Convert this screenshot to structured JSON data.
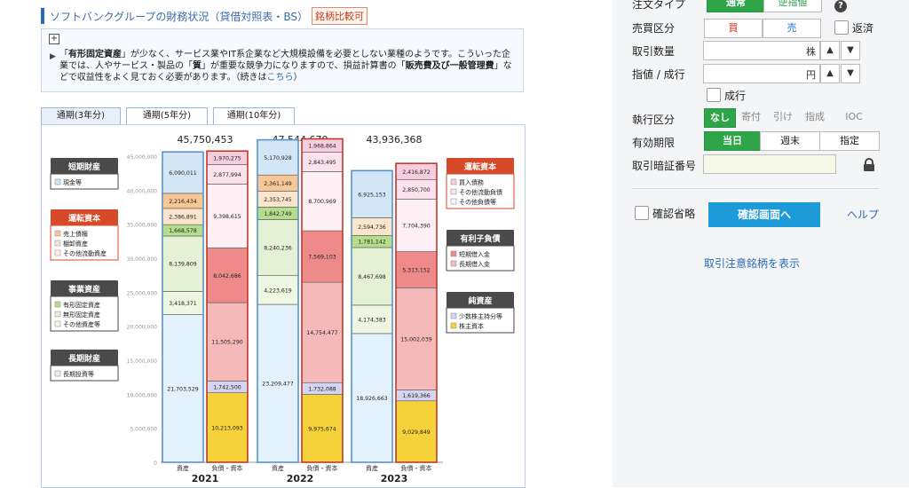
{
  "page": {
    "title": "ソフトバンクグループの財務状況（貸借対照表・BS）",
    "compare_link": "銘柄比較可"
  },
  "info_box": {
    "segments": [
      {
        "text": "「",
        "bold": false
      },
      {
        "text": "有形固定資産",
        "bold": true
      },
      {
        "text": "」が少なく、サービス業やIT系企業など大規模設備を必要としない業種のようです。こういった企業では、人やサービス・製品の「",
        "bold": false
      },
      {
        "text": "質",
        "bold": true
      },
      {
        "text": "」が重要な競争力になりますので、損益計算書の「",
        "bold": false
      },
      {
        "text": "販売費及び一般管理費",
        "bold": true
      },
      {
        "text": "」などで収益性をよく見ておく必要があります。（続きは",
        "bold": false
      }
    ],
    "link_text": "こちら",
    "tail": "）"
  },
  "tabs": [
    {
      "label": "通期(3年分)",
      "active": true
    },
    {
      "label": "通期(5年分)",
      "active": false
    },
    {
      "label": "通期(10年分)",
      "active": false
    }
  ],
  "chart_data": {
    "type": "bar",
    "ylim": [
      0,
      45000000
    ],
    "yticks": [
      "45,000,000",
      "40,000,000",
      "35,000,000",
      "30,000,000",
      "25,000,000",
      "20,000,000",
      "15,000,000",
      "10,000,000",
      "5,000,000",
      "0"
    ],
    "bar_labels": [
      "資産",
      "負債・資本"
    ],
    "years": [
      {
        "year": "2021",
        "total": "45,750,453",
        "assets": [
          {
            "key": "fixed_investment",
            "value": 21703529,
            "label": "21,703,529"
          },
          {
            "key": "other_assets",
            "value": 3418371,
            "label": "3,418,371"
          },
          {
            "key": "intangible",
            "value": 8139809,
            "label": "8,139,809"
          },
          {
            "key": "tangible",
            "value": 1668578,
            "label": "1,668,578"
          },
          {
            "key": "other_current",
            "value": 2386891,
            "label": "2,386,891"
          },
          {
            "key": "inventory",
            "value": 2216434,
            "label": "2,216,434"
          },
          {
            "key": "cash",
            "value": 6090011,
            "label": "6,090,011"
          }
        ],
        "liabilities": [
          {
            "key": "equity",
            "value": 10213093,
            "label": "10,213,093"
          },
          {
            "key": "minority",
            "value": 1742500,
            "label": "1,742,500"
          },
          {
            "key": "long_debt",
            "value": 11505290,
            "label": "11,505,290"
          },
          {
            "key": "short_debt",
            "value": 8042686,
            "label": "8,042,686"
          },
          {
            "key": "other_liab",
            "value": 9398615,
            "label": "9,398,615"
          },
          {
            "key": "other_current_liab",
            "value": 2877994,
            "label": "2,877,994"
          },
          {
            "key": "payables",
            "value": 1970275,
            "label": "1,970,275"
          }
        ]
      },
      {
        "year": "2022",
        "total": "47,544,670",
        "assets": [
          {
            "key": "fixed_investment",
            "value": 23209477,
            "label": "23,209,477"
          },
          {
            "key": "other_assets",
            "value": 4223619,
            "label": "4,223,619"
          },
          {
            "key": "intangible",
            "value": 8240236,
            "label": "8,240,236"
          },
          {
            "key": "tangible",
            "value": 1842749,
            "label": "1,842,749"
          },
          {
            "key": "other_current",
            "value": 2353745,
            "label": "2,353,745"
          },
          {
            "key": "inventory",
            "value": 2361149,
            "label": "2,361,149"
          },
          {
            "key": "cash",
            "value": 5170928,
            "label": "5,170,928"
          }
        ],
        "liabilities": [
          {
            "key": "equity",
            "value": 9975674,
            "label": "9,975,674"
          },
          {
            "key": "minority",
            "value": 1732088,
            "label": "1,732,088"
          },
          {
            "key": "long_debt",
            "value": 14754477,
            "label": "14,754,477"
          },
          {
            "key": "short_debt",
            "value": 7569103,
            "label": "7,569,103"
          },
          {
            "key": "other_liab",
            "value": 8700969,
            "label": "8,700,969"
          },
          {
            "key": "other_current_liab",
            "value": 2843495,
            "label": "2,843,495"
          },
          {
            "key": "payables",
            "value": 1968864,
            "label": "1,968,864"
          }
        ]
      },
      {
        "year": "2023",
        "total": "43,936,368",
        "assets": [
          {
            "key": "fixed_investment",
            "value": 18926663,
            "label": "18,926,663"
          },
          {
            "key": "other_assets",
            "value": 4174383,
            "label": "4,174,383"
          },
          {
            "key": "intangible",
            "value": 8467698,
            "label": "8,467,698"
          },
          {
            "key": "tangible",
            "value": 1781142,
            "label": "1,781,142"
          },
          {
            "key": "other_current",
            "value": 2594736,
            "label": "2,594,736"
          },
          {
            "key": "cash",
            "value": 6925153,
            "label": "6,925,153"
          }
        ],
        "liabilities": [
          {
            "key": "equity",
            "value": 9029849,
            "label": "9,029,849"
          },
          {
            "key": "minority",
            "value": 1619366,
            "label": "1,619,366"
          },
          {
            "key": "long_debt",
            "value": 15002039,
            "label": "15,002,039"
          },
          {
            "key": "short_debt",
            "value": 5313152,
            "label": "5,313,152"
          },
          {
            "key": "other_liab",
            "value": 7704390,
            "label": "7,704,390"
          },
          {
            "key": "other_current_liab",
            "value": 2850700,
            "label": "2,850,700"
          },
          {
            "key": "payables",
            "value": 2416872,
            "label": "2,416,872"
          }
        ]
      }
    ],
    "colors": {
      "cash": "#d3e6f6",
      "inventory": "#f7c796",
      "other_current": "#fbe5cd",
      "tangible": "#b5dd8d",
      "intangible": "#e4f1d4",
      "other_assets": "#eff7e3",
      "fixed_investment": "#e2f1fb",
      "payables": "#f8cede",
      "other_current_liab": "#fce2ec",
      "other_liab": "#fff0f6",
      "short_debt": "#ef8a8a",
      "long_debt": "#f6b9b9",
      "minority": "#d5d5f2",
      "equity": "#f6d23a"
    },
    "legend_left": [
      {
        "title": "短期財産",
        "style": "dark",
        "items": [
          {
            "label": "現金等",
            "color": "#d3e6f6"
          }
        ]
      },
      {
        "title": "運転資本",
        "style": "red",
        "items": [
          {
            "label": "売上債権",
            "color": "#f7c796"
          },
          {
            "label": "棚卸資産",
            "color": "#fbe5cd"
          },
          {
            "label": "その他流動資産",
            "color": "#fdf0e0"
          }
        ]
      },
      {
        "title": "事業資産",
        "style": "dark",
        "items": [
          {
            "label": "有形固定資産",
            "color": "#b5dd8d"
          },
          {
            "label": "無形固定資産",
            "color": "#e4f1d4"
          },
          {
            "label": "その他資産等",
            "color": "#eff7e3"
          }
        ]
      },
      {
        "title": "長期財産",
        "style": "dark",
        "items": [
          {
            "label": "長期投資等",
            "color": "#e2f1fb"
          }
        ]
      }
    ],
    "legend_right": [
      {
        "title": "運転資本",
        "style": "red",
        "items": [
          {
            "label": "買入債務",
            "color": "#f8cede"
          },
          {
            "label": "その他流動負債",
            "color": "#fce2ec"
          },
          {
            "label": "その他負債等",
            "color": "#fff0f6"
          }
        ]
      },
      {
        "title": "有利子負債",
        "style": "dark",
        "items": [
          {
            "label": "短期借入金",
            "color": "#ef8a8a"
          },
          {
            "label": "長期借入金",
            "color": "#f6b9b9"
          }
        ]
      },
      {
        "title": "純資産",
        "style": "dark",
        "items": [
          {
            "label": "少数株主持分等",
            "color": "#d5d5f2"
          },
          {
            "label": "株主資本",
            "color": "#f6d23a"
          }
        ]
      }
    ]
  },
  "order_panel": {
    "order_type_label": "注文タイプ",
    "order_type_options": [
      "通常",
      "逆指値"
    ],
    "side_label": "売買区分",
    "buy": "買",
    "sell": "売",
    "repay": "返済",
    "qty_label": "取引数量",
    "qty_unit": "株",
    "price_label": "指値 / 成行",
    "price_unit": "円",
    "market_order": "成行",
    "exec_label": "執行区分",
    "exec_options": [
      "なし",
      "寄付",
      "引け",
      "指成",
      "IOC"
    ],
    "validity_label": "有効期限",
    "validity_options": [
      "当日",
      "週末",
      "指定"
    ],
    "pin_label": "取引暗証番号",
    "skip_confirm": "確認省略",
    "confirm_button": "確認画面へ",
    "help": "ヘルプ",
    "caution_link": "取引注意銘柄を表示"
  }
}
